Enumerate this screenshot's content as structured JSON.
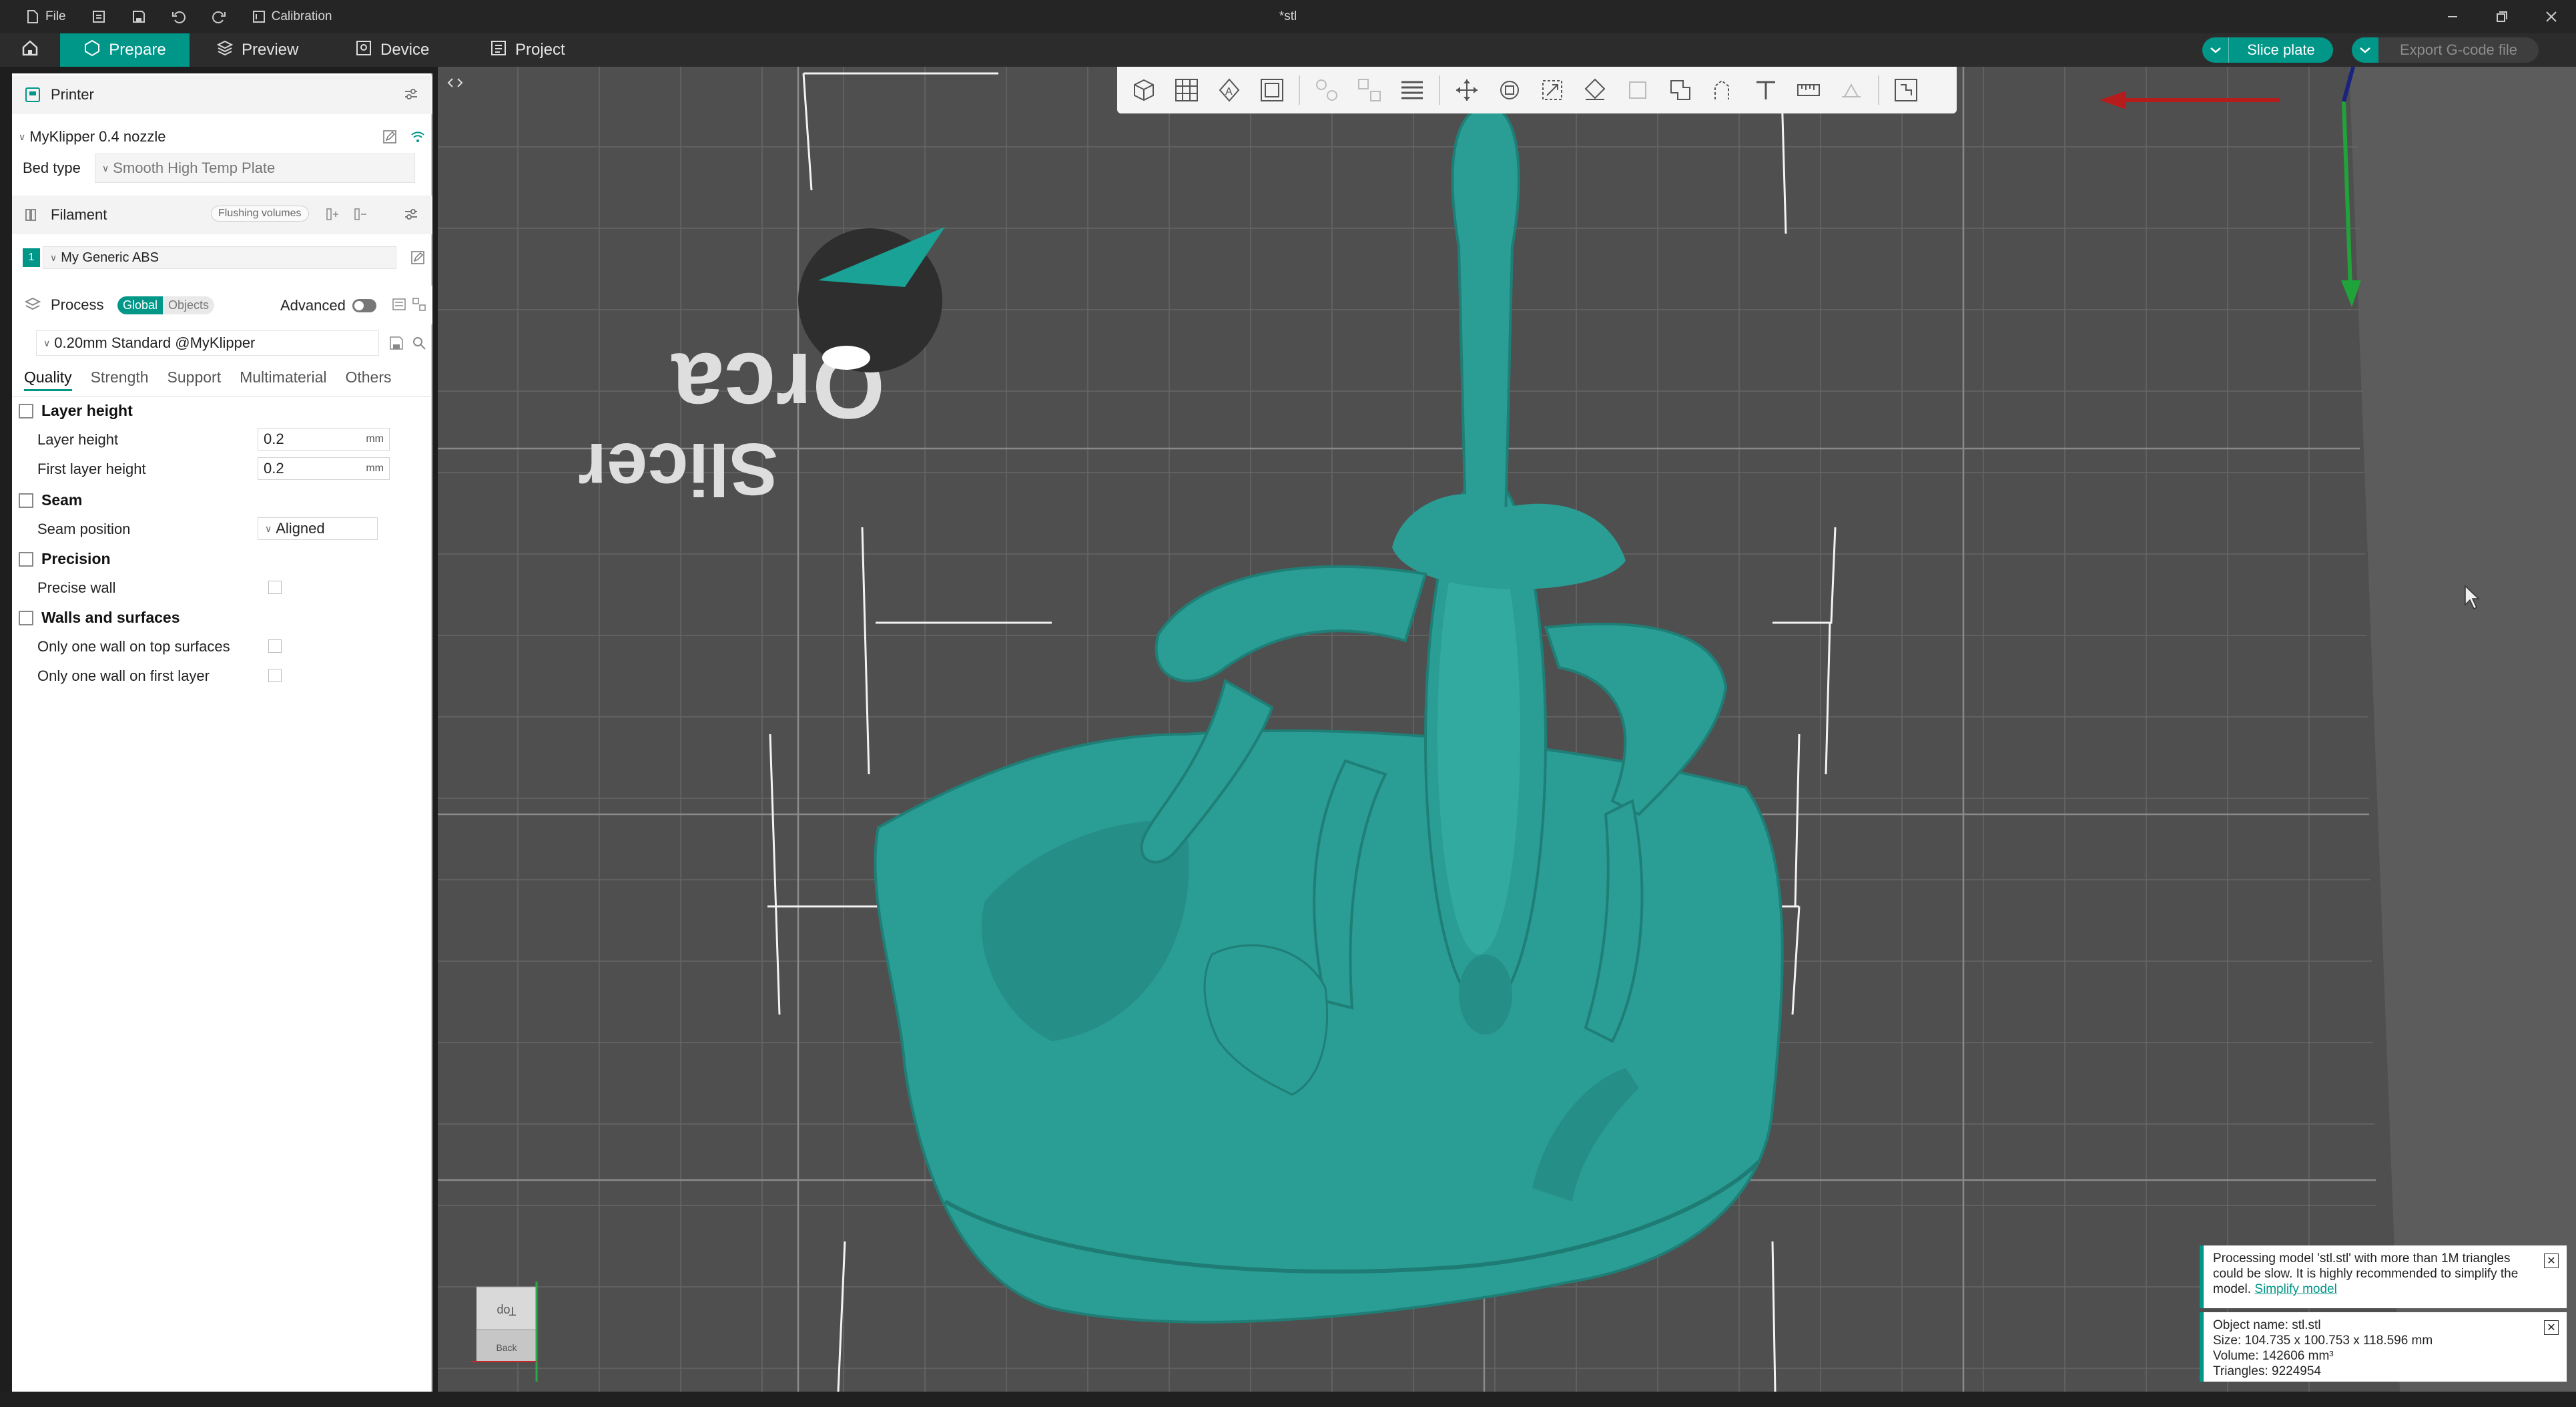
{
  "titlebar": {
    "file_label": "File",
    "calibration_label": "Calibration",
    "window_title": "*stl"
  },
  "nav": {
    "tabs": [
      {
        "label": "Prepare"
      },
      {
        "label": "Preview"
      },
      {
        "label": "Device"
      },
      {
        "label": "Project"
      }
    ],
    "slice_label": "Slice plate",
    "export_label": "Export G-code file"
  },
  "printer": {
    "section_label": "Printer",
    "name": "MyKlipper 0.4 nozzle",
    "bed_type_label": "Bed type",
    "bed_type_value": "Smooth High Temp Plate"
  },
  "filament": {
    "section_label": "Filament",
    "flushing_label": "Flushing volumes",
    "slot_number": "1",
    "name": "My Generic ABS"
  },
  "process": {
    "section_label": "Process",
    "scope_global": "Global",
    "scope_objects": "Objects",
    "advanced_label": "Advanced",
    "profile": "0.20mm Standard @MyKlipper"
  },
  "settings_tabs": [
    "Quality",
    "Strength",
    "Support",
    "Multimaterial",
    "Others"
  ],
  "quality": {
    "layer_height_group": "Layer height",
    "layer_height_label": "Layer height",
    "layer_height_value": "0.2",
    "first_layer_label": "First layer height",
    "first_layer_value": "0.2",
    "unit": "mm",
    "seam_group": "Seam",
    "seam_position_label": "Seam position",
    "seam_position_value": "Aligned",
    "precision_group": "Precision",
    "precise_wall_label": "Precise wall",
    "walls_group": "Walls and surfaces",
    "one_wall_top_label": "Only one wall on top surfaces",
    "one_wall_first_label": "Only one wall on first layer"
  },
  "viewport": {
    "logo_word1": "Orca",
    "logo_word2": "Slicer",
    "cube_top": "Top",
    "cube_back": "Back"
  },
  "notifications": {
    "warning_text": "Processing model 'stl.stl' with more than 1M triangles could be slow. It is highly recommended to simplify the model.",
    "simplify_link": "Simplify model",
    "object_name": "Object name: stl.stl",
    "size": "Size: 104.735 x 100.753 x 118.596 mm",
    "volume": "Volume: 142606 mm³",
    "triangles": "Triangles: 9224954"
  },
  "colors": {
    "accent": "#009688",
    "model": "#2a9d94",
    "plate": "#4f4f4f"
  }
}
